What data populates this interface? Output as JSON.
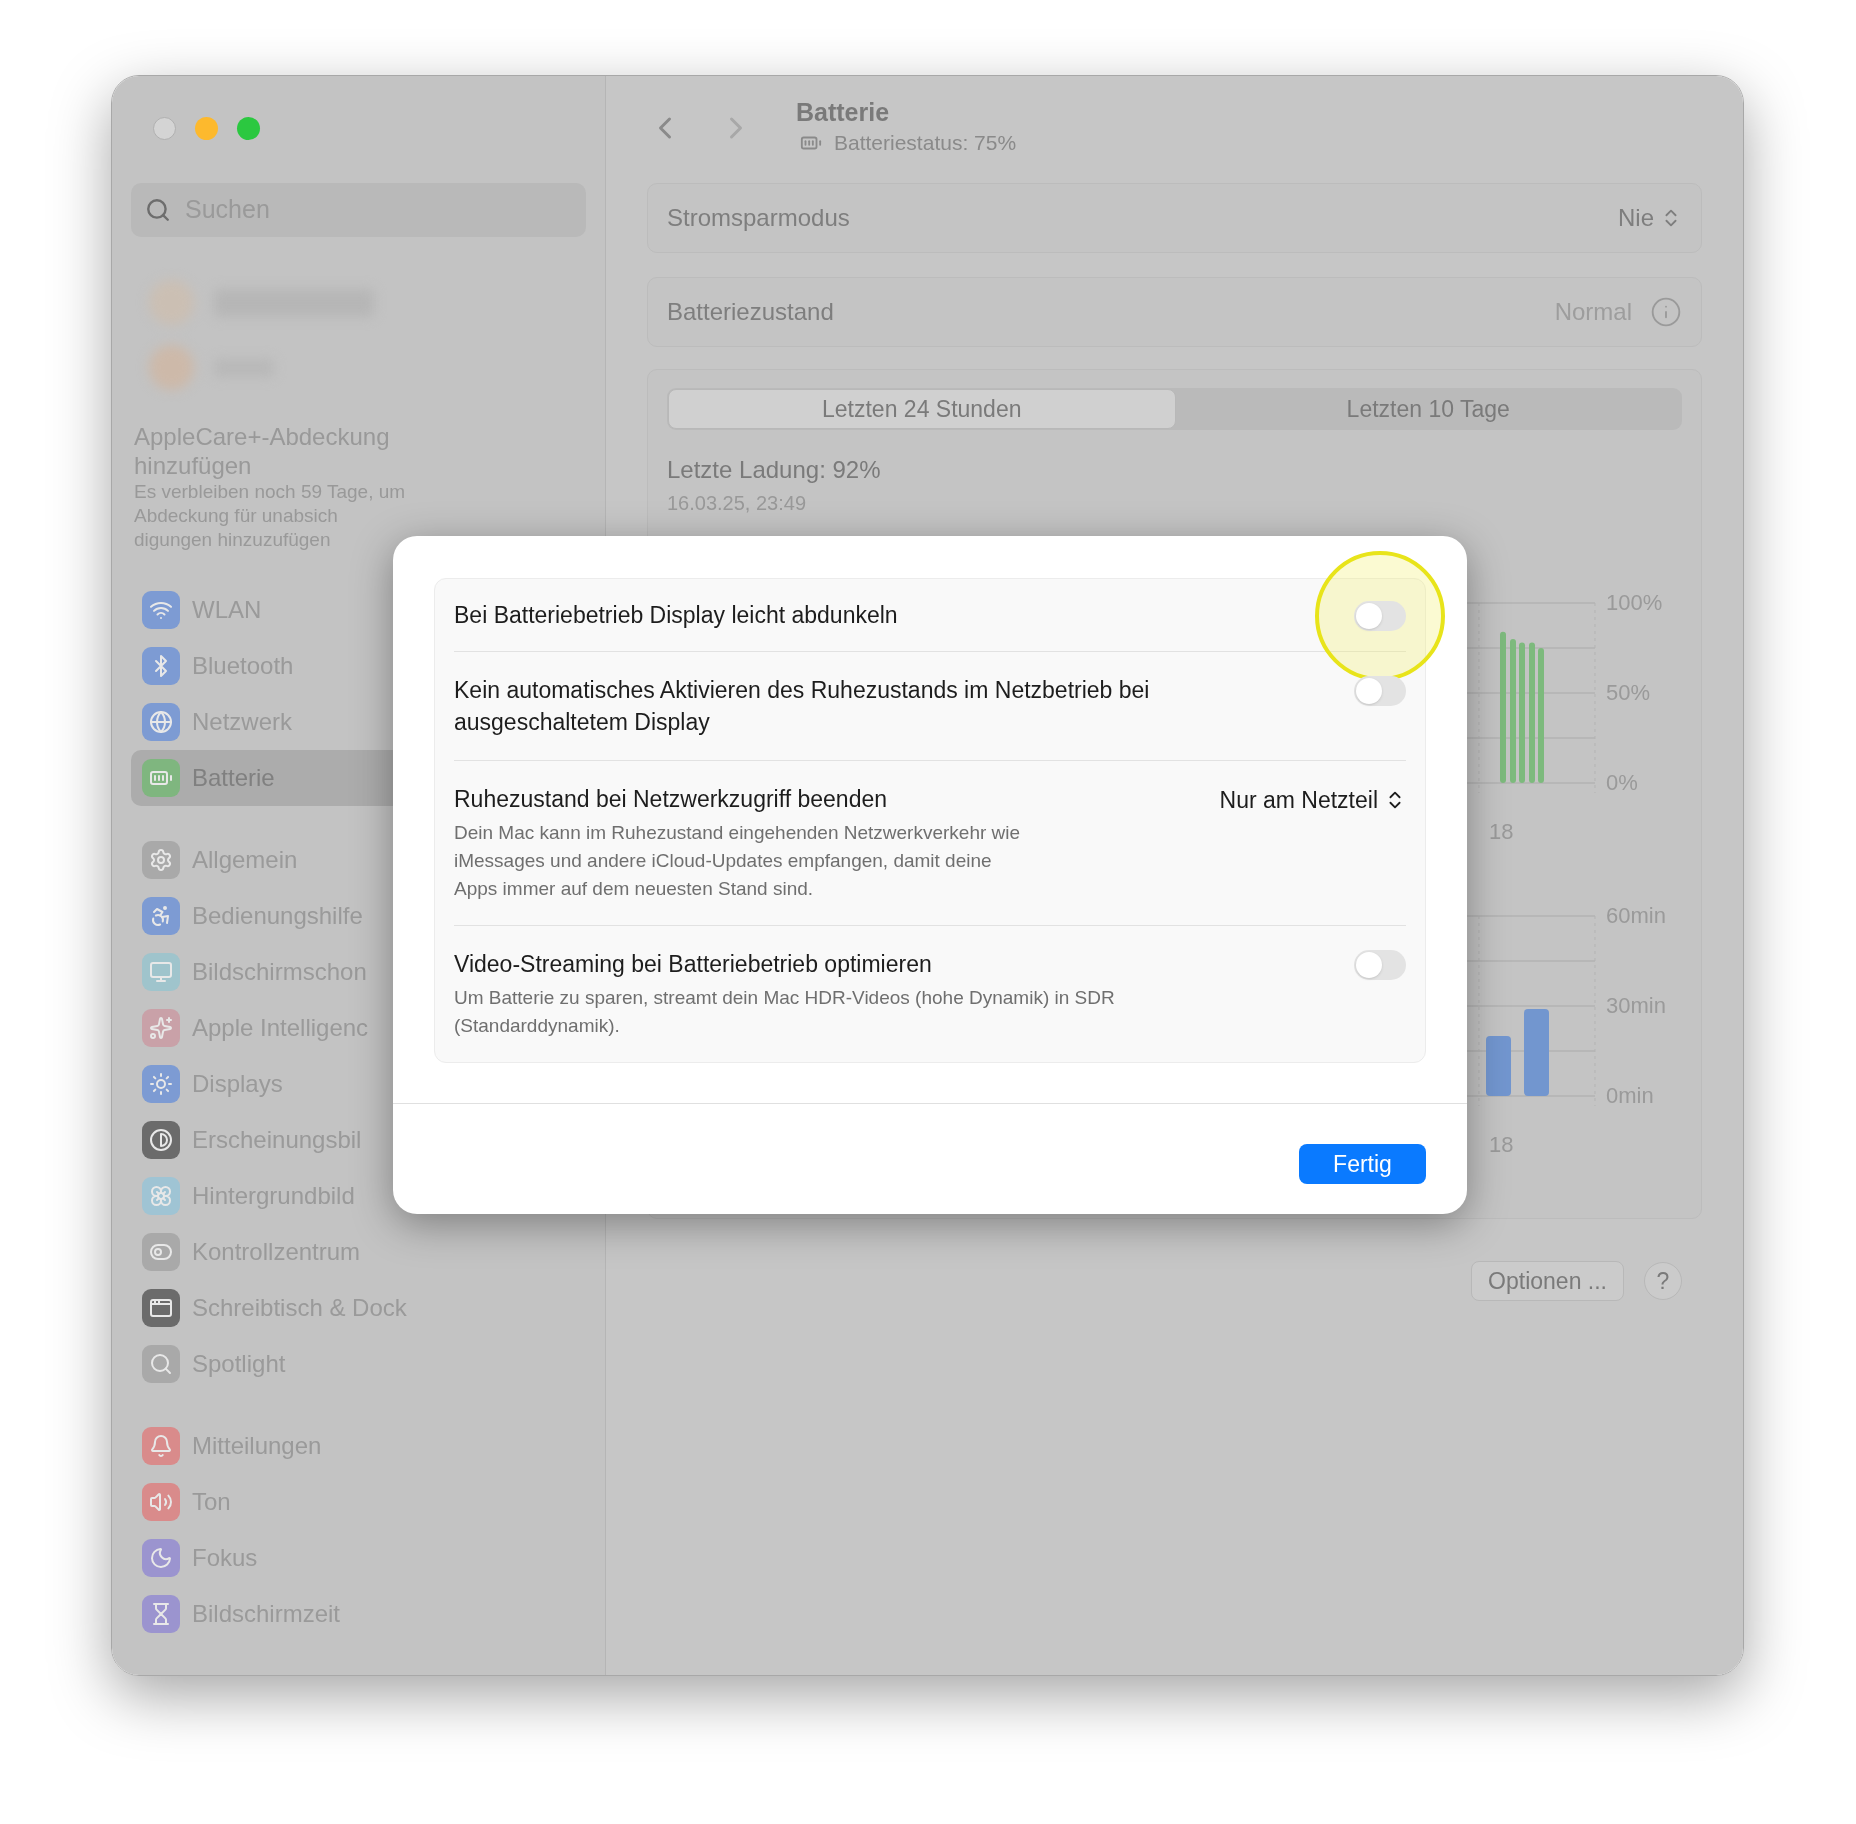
{
  "sidebar": {
    "search": {
      "placeholder": "Suchen"
    },
    "applecare": {
      "title": "AppleCare+-Abdeckung hinzufügen",
      "lines": [
        "Es verbleiben noch 59 Tage, um",
        "Abdeckung für unabsich",
        "digungen hinzuzufügen"
      ]
    },
    "groups": [
      [
        {
          "label": "WLAN",
          "selected": false,
          "color": "#7d9bd3"
        },
        {
          "label": "Bluetooth",
          "selected": false,
          "color": "#7d9bd3"
        },
        {
          "label": "Netzwerk",
          "selected": false,
          "color": "#7d9bd3"
        },
        {
          "label": "Batterie",
          "selected": true,
          "color": "#7fb67f"
        }
      ],
      [
        {
          "label": "Allgemein",
          "selected": false,
          "color": "#a9a9a9"
        },
        {
          "label": "Bedienungshilfe",
          "selected": false,
          "color": "#7d9bd3"
        },
        {
          "label": "Bildschirmschon",
          "selected": false,
          "color": "#9fc4cc"
        },
        {
          "label": "Apple Intelligenc",
          "selected": false,
          "color": "#c9a1a8"
        },
        {
          "label": "Displays",
          "selected": false,
          "color": "#7d9bd3"
        },
        {
          "label": "Erscheinungsbil",
          "selected": false,
          "color": "#6b6b6b"
        },
        {
          "label": "Hintergrundbild",
          "selected": false,
          "color": "#9fc4d4"
        },
        {
          "label": "Kontrollzentrum",
          "selected": false,
          "color": "#a9a9a9"
        },
        {
          "label": "Schreibtisch & Dock",
          "selected": false,
          "color": "#6b6b6b"
        },
        {
          "label": "Spotlight",
          "selected": false,
          "color": "#a9a9a9"
        }
      ],
      [
        {
          "label": "Mitteilungen",
          "selected": false,
          "color": "#d98b8b"
        },
        {
          "label": "Ton",
          "selected": false,
          "color": "#d98b8b"
        },
        {
          "label": "Fokus",
          "selected": false,
          "color": "#9b94cf"
        },
        {
          "label": "Bildschirmzeit",
          "selected": false,
          "color": "#9b94cf"
        }
      ]
    ]
  },
  "header": {
    "title": "Batterie",
    "status": "Batteriestatus: 75%"
  },
  "settings": [
    {
      "kind": "popup",
      "label": "Stromsparmodus",
      "value": "Nie"
    },
    {
      "kind": "info",
      "label": "Batteriezustand",
      "value": "Normal"
    }
  ],
  "history": {
    "tabs": [
      {
        "label": "Letzten 24 Stunden",
        "selected": true
      },
      {
        "label": "Letzten 10 Tage",
        "selected": false
      }
    ],
    "last_charge": "Letzte Ladung: 92%",
    "last_charge_time": "16.03.25, 23:49",
    "level_chart": {
      "yticks": [
        "100%",
        "50%",
        "0%"
      ],
      "xlabel": "18"
    },
    "usage_chart": {
      "yticks": [
        "60min",
        "30min",
        "0min"
      ],
      "xlabel": "18"
    }
  },
  "options_button": "Optionen ...",
  "help_button": "?",
  "dialog": {
    "rows": [
      {
        "kind": "toggle",
        "title": "Bei Batteriebetrieb Display leicht abdunkeln",
        "on": false,
        "highlighted": true
      },
      {
        "kind": "toggle",
        "title": "Kein automatisches Aktivieren des Ruhezustands im Netzbetrieb bei ausgeschaltetem Display",
        "on": false
      },
      {
        "kind": "popup",
        "title": "Ruhezustand bei Netzwerkzugriff beenden",
        "value": "Nur am Netzteil",
        "description": "Dein Mac kann im Ruhezustand eingehenden Netzwerkverkehr wie iMessages und andere iCloud-Updates empfangen, damit deine Apps immer auf dem neuesten Stand sind."
      },
      {
        "kind": "toggle",
        "title": "Video-Streaming bei Batteriebetrieb optimieren",
        "on": false,
        "description": "Um Batterie zu sparen, streamt dein Mac HDR-Videos (hohe Dynamik) in SDR (Standarddynamik)."
      }
    ],
    "done_button": "Fertig"
  }
}
